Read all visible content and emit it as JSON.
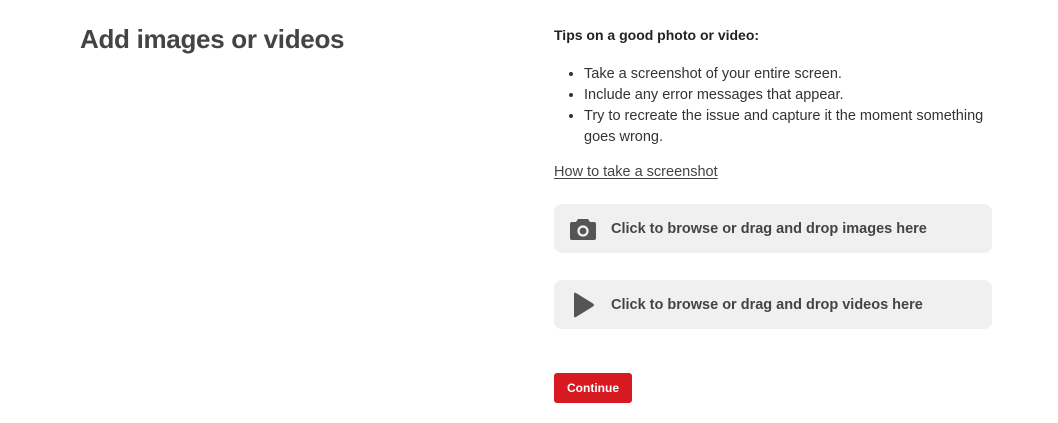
{
  "page": {
    "title": "Add images or videos"
  },
  "tips": {
    "heading": "Tips on a good photo or video:",
    "items": [
      "Take a screenshot of your entire screen.",
      "Include any error messages that appear.",
      "Try to recreate the issue and capture it the moment something goes wrong."
    ]
  },
  "help_link": {
    "label": "How to take a screenshot"
  },
  "upload": {
    "images": {
      "icon": "camera-icon",
      "label": "Click to browse or drag and drop images here"
    },
    "videos": {
      "icon": "play-icon",
      "label": "Click to browse or drag and drop videos here"
    }
  },
  "actions": {
    "continue_label": "Continue"
  },
  "colors": {
    "accent": "#d71921",
    "drop_zone_bg": "#f0f0f0",
    "icon": "#555555"
  }
}
